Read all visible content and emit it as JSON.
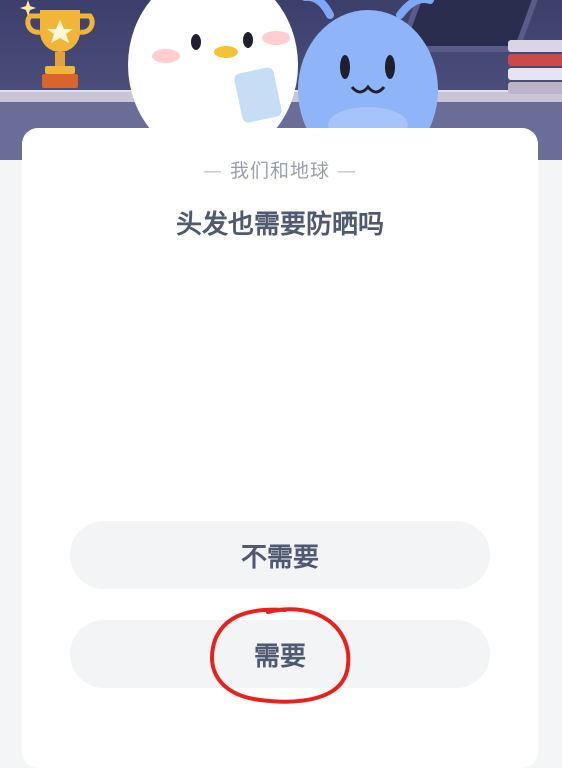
{
  "quiz": {
    "category": "我们和地球",
    "category_dash": "—",
    "question": "头发也需要防晒吗",
    "options": [
      {
        "label": "不需要"
      },
      {
        "label": "需要"
      }
    ]
  },
  "colors": {
    "banner": "#4a4c7a",
    "card": "#ffffff",
    "option_bg": "#f2f4f6",
    "text": "#4f5a72",
    "annotation": "#e8211c"
  }
}
